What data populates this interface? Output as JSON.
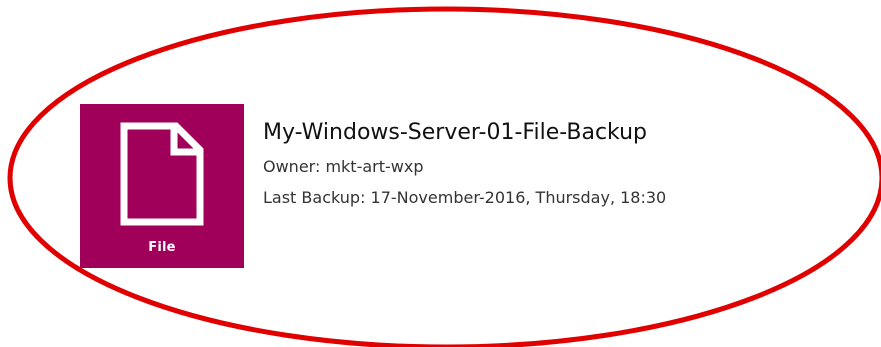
{
  "backup": {
    "tile_label": "File",
    "name": "My-Windows-Server-01-File-Backup",
    "owner_line": "Owner: mkt-art-wxp",
    "last_backup_line": "Last Backup: 17-November-2016, Thursday, 18:30",
    "tile_color": "#a0005a",
    "icon": "file-icon"
  },
  "annotation": {
    "shape": "ellipse",
    "color": "#e00000"
  }
}
